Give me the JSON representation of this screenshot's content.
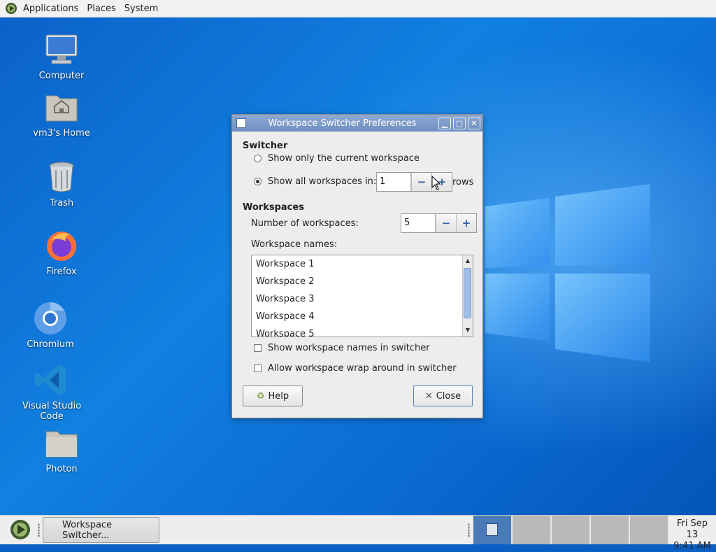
{
  "top_panel": {
    "menus": [
      "Applications",
      "Places",
      "System"
    ]
  },
  "desktop_icons": [
    {
      "label": "Computer",
      "icon": "computer-icon"
    },
    {
      "label": "vm3's Home",
      "icon": "home-folder-icon"
    },
    {
      "label": "Trash",
      "icon": "trash-icon"
    },
    {
      "label": "Firefox",
      "icon": "firefox-icon"
    },
    {
      "label": "Chromium",
      "icon": "chromium-icon"
    },
    {
      "label": "Visual Studio Code",
      "icon": "vscode-icon"
    },
    {
      "label": "Photon",
      "icon": "folder-icon"
    }
  ],
  "dialog": {
    "title": "Workspace Switcher Preferences",
    "switcher": {
      "heading": "Switcher",
      "option_current": "Show only the current workspace",
      "option_all": "Show all workspaces in:",
      "selected": "all",
      "rows_value": "1",
      "rows_suffix": "rows"
    },
    "workspaces": {
      "heading": "Workspaces",
      "number_label": "Number of workspaces:",
      "number_value": "5",
      "names_label": "Workspace names:",
      "names": [
        "Workspace 1",
        "Workspace 2",
        "Workspace 3",
        "Workspace 4",
        "Workspace 5"
      ]
    },
    "show_names_label": "Show workspace names in switcher",
    "show_names_checked": false,
    "wrap_label": "Allow workspace wrap around in switcher",
    "wrap_checked": false,
    "help_label": "Help",
    "close_label": "Close"
  },
  "taskbar": {
    "task_label": "Workspace Switcher...",
    "workspace_count": 5,
    "active_workspace": 1,
    "clock_date": "Fri Sep 13",
    "clock_time": "9:41 AM"
  },
  "colors": {
    "titlebar": "#7a98c9",
    "desktop": "#0a6bd4",
    "active_workspace": "#4a7ab8"
  }
}
